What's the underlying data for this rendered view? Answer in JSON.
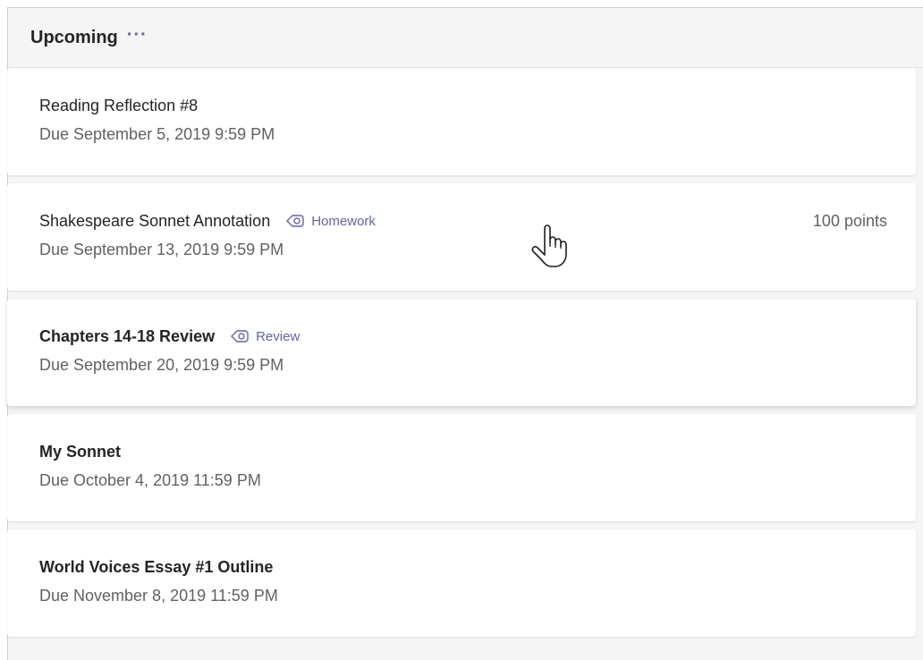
{
  "header": {
    "title": "Upcoming",
    "more_label": "···"
  },
  "assignments": [
    {
      "title": "Reading Reflection #8",
      "due": "Due September 5, 2019 9:59 PM"
    },
    {
      "title": "Shakespeare Sonnet Annotation",
      "tag": "Homework",
      "due": "Due September 13, 2019 9:59 PM",
      "points": "100 points"
    },
    {
      "title": "Chapters 14-18 Review",
      "tag": "Review",
      "due": "Due September 20, 2019 9:59 PM"
    },
    {
      "title": "My Sonnet",
      "due": "Due October 4, 2019 11:59 PM"
    },
    {
      "title": "World Voices Essay #1 Outline",
      "due": "Due November 8, 2019 11:59 PM"
    }
  ],
  "colors": {
    "accent": "#6264a7",
    "text_primary": "#252423",
    "text_secondary": "#616161",
    "panel_bg": "#f5f5f5"
  },
  "icons": {
    "tag": "tag-icon",
    "more": "more-icon",
    "cursor": "hand-pointer-icon"
  }
}
